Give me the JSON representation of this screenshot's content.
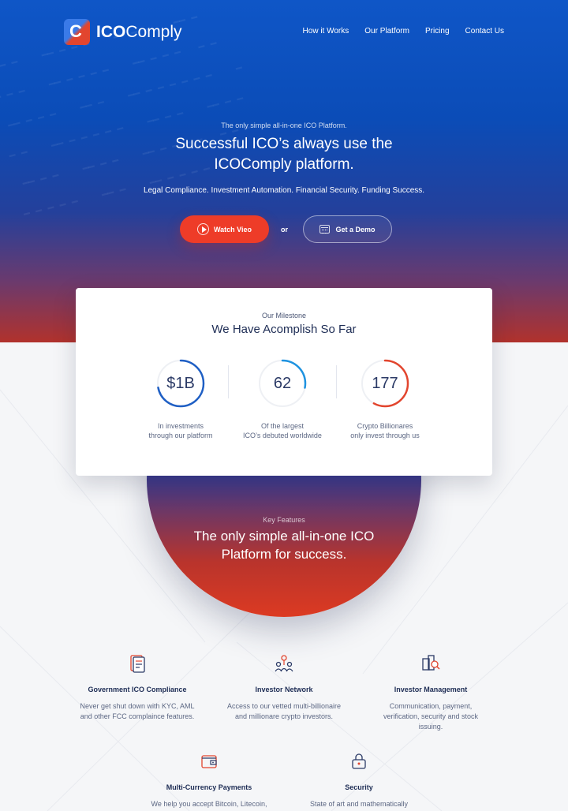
{
  "brand": {
    "logo_letter": "C",
    "name_bold": "ICO",
    "name_light": "Comply"
  },
  "nav": {
    "items": [
      "How it Works",
      "Our Platform",
      "Pricing",
      "Contact Us"
    ]
  },
  "hero": {
    "eyebrow": "The only simple all-in-one ICO Platform.",
    "title": "Successful ICO’s always use the ICOComply platform.",
    "subtitle": "Legal Compliance. Investment Automation. Financial Security. Funding Success.",
    "watch_label": "Watch Vieo",
    "or_label": "or",
    "demo_label": "Get a Demo"
  },
  "milestone": {
    "eyebrow": "Our Milestone",
    "title": "We Have Acomplish So Far",
    "stats": [
      {
        "value": "$1B",
        "label_line1": "In investments",
        "label_line2": "through our platform",
        "progress": 0.72,
        "color": "#1f5fc4"
      },
      {
        "value": "62",
        "label_line1": "Of the largest",
        "label_line2": "ICO’s debuted worldwide",
        "progress": 0.28,
        "color": "#1f93e0"
      },
      {
        "value": "177",
        "label_line1": "Crypto Billionares",
        "label_line2": "only invest through us",
        "progress": 0.58,
        "color": "#e2452e"
      }
    ]
  },
  "key_features": {
    "eyebrow": "Key Features",
    "title": "The only simple all-in-one ICO Platform for success."
  },
  "features": [
    {
      "icon": "document-icon",
      "title": "Government ICO Compliance",
      "desc": "Never get shut down with KYC, AML and other FCC complaince features."
    },
    {
      "icon": "network-icon",
      "title": "Investor Network",
      "desc": "Access to our vetted multi-billionaire and millionare crypto investors."
    },
    {
      "icon": "management-icon",
      "title": "Investor Management",
      "desc": "Communication, payment, verification, security and stock issuing."
    },
    {
      "icon": "wallet-icon",
      "title": "Multi-Currency Payments",
      "desc": "We help you accept Bitcoin, Litecoin,"
    },
    {
      "icon": "lock-icon",
      "title": "Security",
      "desc": "State of art and mathematically"
    }
  ],
  "colors": {
    "accent_red": "#ee3c28",
    "brand_blue": "#0f56c7",
    "navy_text": "#1e2d55"
  }
}
